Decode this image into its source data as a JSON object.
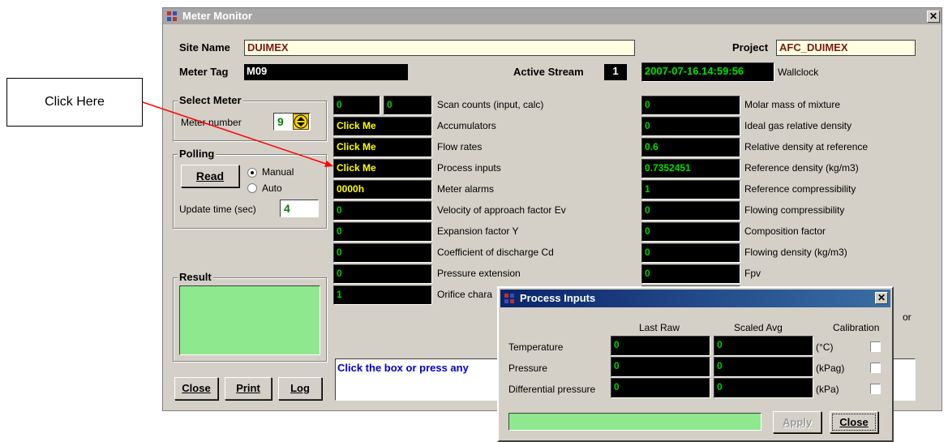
{
  "callout": {
    "text": "Click Here"
  },
  "main_window": {
    "title": "Meter Monitor",
    "close_glyph": "✕",
    "site_name_label": "Site Name",
    "site_name_value": "DUIMEX",
    "project_label": "Project",
    "project_value": "AFC_DUIMEX",
    "meter_tag_label": "Meter Tag",
    "meter_tag_value": "M09",
    "active_stream_label": "Active Stream",
    "active_stream_value": "1",
    "wallclock_value": "2007-07-16.14:59:56",
    "wallclock_label": "Wallclock",
    "select_meter": {
      "title": "Select Meter",
      "meter_number_label": "Meter number",
      "meter_number_value": "9"
    },
    "polling": {
      "title": "Polling",
      "read_button": "Read",
      "manual_label": "Manual",
      "auto_label": "Auto",
      "update_time_label": "Update time (sec)",
      "update_time_value": "4"
    },
    "result": {
      "title": "Result"
    },
    "buttons": {
      "close": "Close",
      "print": "Print",
      "log": "Log"
    },
    "message_text": "Click the box or press any",
    "scan_counts": {
      "input": "0",
      "calc": "0",
      "label": "Scan counts (input, calc)"
    },
    "left_rows": [
      {
        "value": "Click Me",
        "label": "Accumulators"
      },
      {
        "value": "Click Me",
        "label": "Flow rates"
      },
      {
        "value": "Click Me",
        "label": "Process inputs"
      },
      {
        "value": "0000h",
        "label": "Meter alarms"
      },
      {
        "value": "0",
        "label": "Velocity of approach factor Ev"
      },
      {
        "value": "0",
        "label": "Expansion factor Y"
      },
      {
        "value": "0",
        "label": "Coefficient of discharge Cd"
      },
      {
        "value": "0",
        "label": "Pressure extension"
      },
      {
        "value": "1",
        "label": "Orifice chara"
      }
    ],
    "right_rows": [
      {
        "value": "0",
        "label": "Molar mass of mixture"
      },
      {
        "value": "0",
        "label": "Ideal gas relative density"
      },
      {
        "value": "0.6",
        "label": "Relative density at reference"
      },
      {
        "value": "0.7352451",
        "label": "Reference density (kg/m3)"
      },
      {
        "value": "1",
        "label": "Reference compressibility"
      },
      {
        "value": "0",
        "label": "Flowing compressibility"
      },
      {
        "value": "0",
        "label": "Composition factor"
      },
      {
        "value": "0",
        "label": "Flowing density (kg/m3)"
      },
      {
        "value": "0",
        "label": "Fpv"
      }
    ],
    "partial_right_label": "or"
  },
  "process_inputs": {
    "title": "Process Inputs",
    "close_glyph": "✕",
    "col_last_raw": "Last Raw",
    "col_scaled_avg": "Scaled Avg",
    "col_calibration": "Calibration",
    "rows": [
      {
        "label": "Temperature",
        "raw": "0",
        "scaled": "0",
        "unit": "(°C)"
      },
      {
        "label": "Pressure",
        "raw": "0",
        "scaled": "0",
        "unit": "(kPag)"
      },
      {
        "label": "Differential pressure",
        "raw": "0",
        "scaled": "0",
        "unit": "(kPa)"
      }
    ],
    "apply_button": "Apply",
    "close_button": "Close"
  },
  "colors": {
    "window_bg": "#d4d0c8",
    "inactive_title": "#a6a6a6",
    "active_title": "#0a246a",
    "value_green": "#00d000",
    "value_yellow": "#ffff00",
    "result_green": "#8ee88e",
    "callout_arrow": "#ff0000"
  }
}
